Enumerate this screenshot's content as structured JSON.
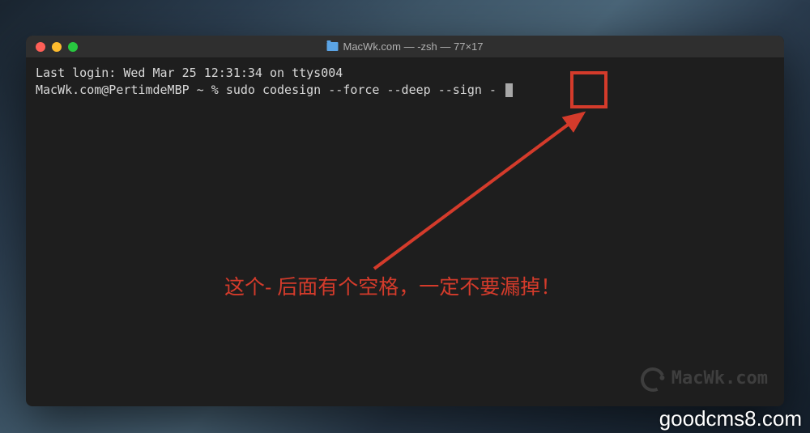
{
  "window": {
    "title": "MacWk.com — -zsh — 77×17"
  },
  "terminal": {
    "last_login": "Last login: Wed Mar 25 12:31:34 on ttys004",
    "prompt": "MacWk.com@PertimdeMBP ~ % ",
    "command": "sudo codesign --force --deep --sign - "
  },
  "annotation": {
    "text": "这个- 后面有个空格，一定不要漏掉！"
  },
  "watermark": {
    "brand": "MacWk.com",
    "footer": "goodcms8.com"
  },
  "colors": {
    "titlebar": "#2f2f2f",
    "terminal_bg": "#1e1e1e",
    "terminal_fg": "#d8d8d8",
    "annotation_red": "#d43b2b"
  }
}
